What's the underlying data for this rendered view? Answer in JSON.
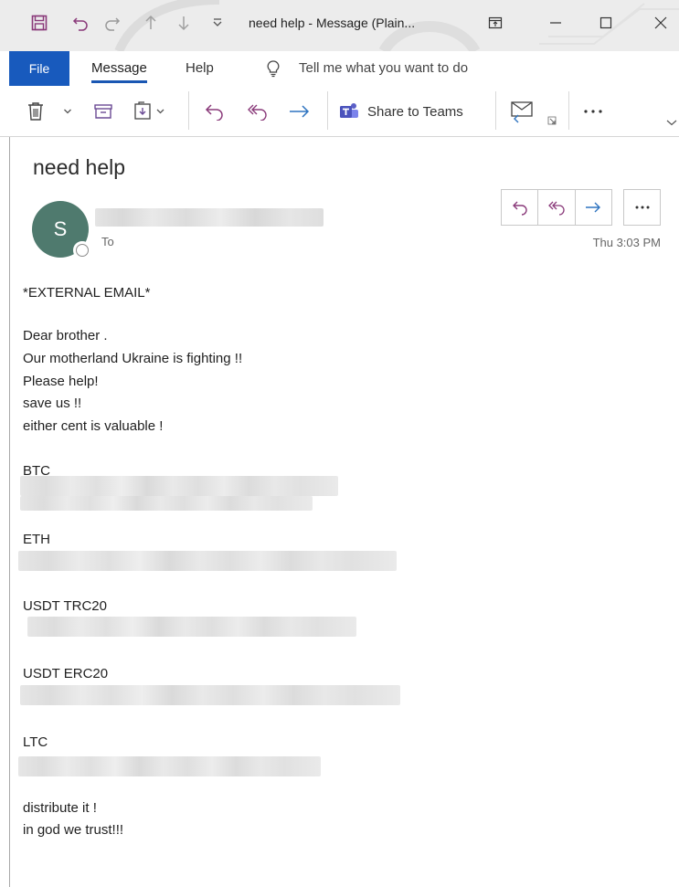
{
  "window": {
    "title": "need help  -  Message (Plain..."
  },
  "menu": {
    "file": "File",
    "message": "Message",
    "help": "Help",
    "tell_me": "Tell me what you want to do"
  },
  "ribbon": {
    "share_to_teams": "Share to Teams"
  },
  "message": {
    "subject": "need help",
    "avatar_initial": "S",
    "to_label": "To",
    "timestamp": "Thu 3:03 PM"
  },
  "body": {
    "external": "*EXTERNAL EMAIL*",
    "line1": "Dear brother .",
    "line2": "Our motherland Ukraine is fighting !!",
    "line3": "Please help!",
    "line4": "save us !!",
    "line5": "either cent is valuable !",
    "btc": "BTC",
    "eth": "ETH",
    "usdt_trc20": "USDT TRC20",
    "usdt_erc20": "USDT ERC20",
    "ltc": "LTC",
    "closing1": "distribute it !",
    "closing2": "in god we trust!!!"
  },
  "colors": {
    "file_tab": "#185abd",
    "accent_purple": "#8a3a7a",
    "accent_blue": "#2f74c0",
    "avatar": "#4f7a6e"
  }
}
